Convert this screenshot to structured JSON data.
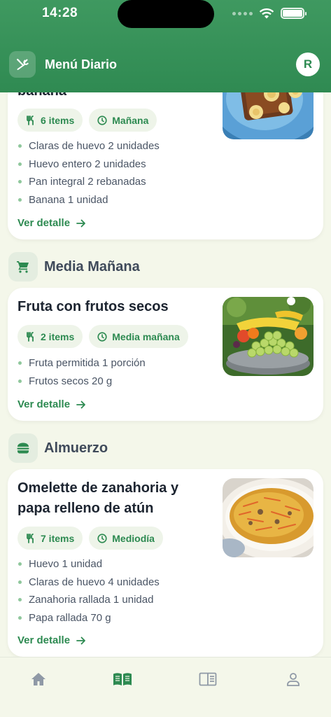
{
  "status": {
    "time": "14:28"
  },
  "header": {
    "title": "Menú Diario",
    "avatar_initial": "R"
  },
  "colors": {
    "primary": "#2d8a51",
    "header_gradient_top": "#3f9960",
    "chip_bg": "#eef4e9",
    "background": "#f4f7ea"
  },
  "meals": [
    {
      "section": "",
      "title": "banana",
      "items_label": "6 items",
      "time_label": "Mañana",
      "ingredients": [
        "Claras de huevo 2 unidades",
        "Huevo entero 2 unidades",
        "Pan integral 2 rebanadas",
        "Banana 1 unidad"
      ],
      "detail_label": "Ver detalle",
      "image": "french-toast-with-banana-photo"
    },
    {
      "section": "Media Mañana",
      "section_icon": "cart-icon",
      "title": "Fruta con frutos secos",
      "items_label": "2 items",
      "time_label": "Media mañana",
      "ingredients": [
        "Fruta permitida 1 porción",
        "Frutos secos 20 g"
      ],
      "detail_label": "Ver detalle",
      "image": "fruit-bowl-photo"
    },
    {
      "section": "Almuerzo",
      "section_icon": "burger-icon",
      "title": "Omelette de zanahoria y papa relleno de atún",
      "items_label": "7 items",
      "time_label": "Mediodía",
      "ingredients": [
        "Huevo 1 unidad",
        "Claras de huevo 4 unidades",
        "Zanahoria rallada 1 unidad",
        "Papa rallada 70 g"
      ],
      "detail_label": "Ver detalle",
      "image": "omelette-photo"
    }
  ],
  "nav": [
    {
      "name": "home",
      "icon": "home-icon",
      "active": false
    },
    {
      "name": "menu",
      "icon": "book-icon",
      "active": true
    },
    {
      "name": "recipes",
      "icon": "reader-icon",
      "active": false
    },
    {
      "name": "profile",
      "icon": "person-icon",
      "active": false
    }
  ]
}
